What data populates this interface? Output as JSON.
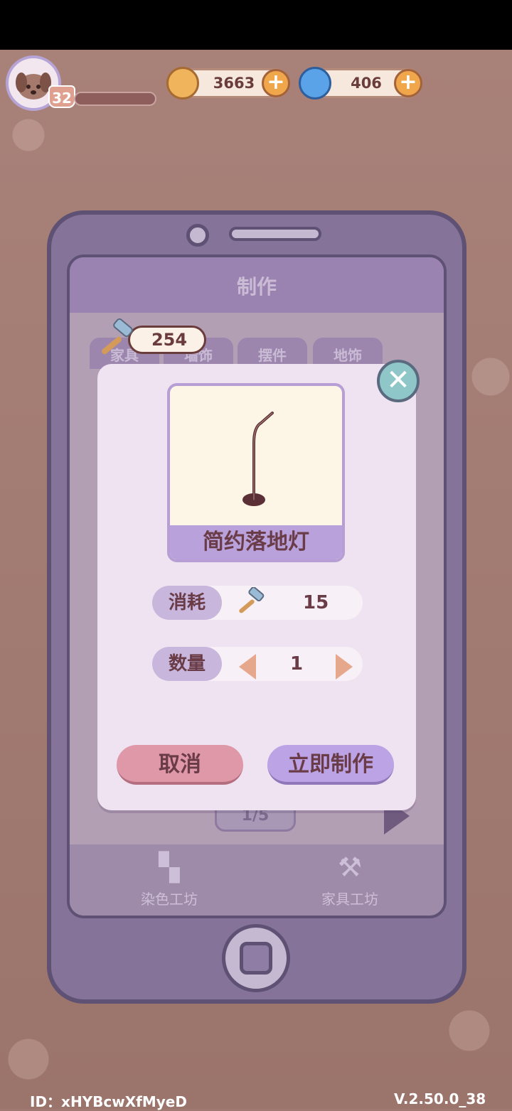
{
  "hud": {
    "level": "32",
    "coins": "3663",
    "gems": "406"
  },
  "screen": {
    "title": "制作",
    "hammer_count": "254",
    "tabs": [
      "家具",
      "墙饰",
      "摆件",
      "地饰"
    ],
    "pager": "1/5",
    "footer": [
      {
        "label": "染色工坊",
        "icon": "paint-roller-icon"
      },
      {
        "label": "家具工坊",
        "icon": "wrench-icon"
      }
    ]
  },
  "modal": {
    "item_name": "简约落地灯",
    "cost_label": "消耗",
    "cost_value": "15",
    "qty_label": "数量",
    "qty_value": "1",
    "cancel_label": "取消",
    "make_label": "立即制作"
  },
  "footer": {
    "id": "ID：xHYBcwXfMyeD",
    "version": "V.2.50.0_38"
  },
  "colors": {
    "accent_purple": "#b9a1dc",
    "cancel_pink": "#df98a8",
    "text_brown": "#6a3c47"
  }
}
